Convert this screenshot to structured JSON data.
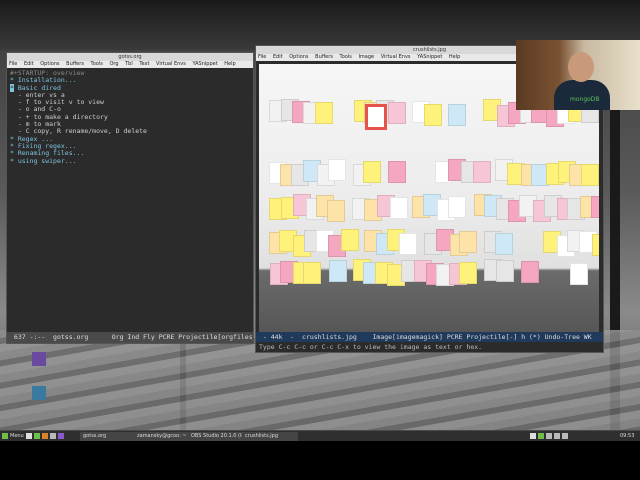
{
  "left_window": {
    "title": "gotss.org",
    "menu": [
      "File",
      "Edit",
      "Options",
      "Buffers",
      "Tools",
      "Org",
      "Tbl",
      "Text",
      "Virtual Envs",
      "YASnippet",
      "Help"
    ],
    "startup_line": "#+STARTUP: overview",
    "lines": [
      {
        "text": "* Installation...",
        "style": "hdr"
      },
      {
        "text": "",
        "style": ""
      },
      {
        "text": "* Basic dired",
        "style": "hdr-cursor"
      },
      {
        "text": "  - enter vs a",
        "style": ""
      },
      {
        "text": "  - f to visit v to view",
        "style": ""
      },
      {
        "text": "  - o and C-o",
        "style": ""
      },
      {
        "text": "  - + to make a directory",
        "style": ""
      },
      {
        "text": "  - m to mark",
        "style": ""
      },
      {
        "text": "  - C copy, R rename/move, D delete",
        "style": ""
      },
      {
        "text": "",
        "style": ""
      },
      {
        "text": "* Regex ...",
        "style": "hdr"
      },
      {
        "text": "",
        "style": ""
      },
      {
        "text": "* Fixing regex...",
        "style": "hdr"
      },
      {
        "text": "",
        "style": ""
      },
      {
        "text": "* Renaming files...",
        "style": "hdr"
      },
      {
        "text": "",
        "style": ""
      },
      {
        "text": "* using swiper...",
        "style": "hdr"
      }
    ],
    "modeline": " 637 -:--  gotss.org      Org Ind Fly PCRE Projectile[orgfiles] h (+)"
  },
  "right_window": {
    "title": "crushlists.jpg",
    "menu": [
      "File",
      "Edit",
      "Options",
      "Buffers",
      "Tools",
      "Image",
      "Virtual Envs",
      "YASnippet",
      "Help"
    ],
    "modeline": " - 44k  -  crushlists.jpg    Image[imagemagick] PCRE Projectile[-] h (*) Undo-Tree WK   Mail [23",
    "minibuffer": "Type C-c C-c or C-c C-x to view the image as text or hex."
  },
  "webcam": {
    "shirt_text": "mongoDB"
  },
  "desktop_icons": [
    {
      "label": "",
      "color": "#6a4aa0"
    },
    {
      "label": "",
      "color": "#3a7aa0"
    }
  ],
  "taskbar": {
    "menu_label": "Menu",
    "tasks": [
      "gotss.org",
      "zamansky@gcoo: ~",
      "OBS Studio 20.1.0 (li...",
      "crushlists.jpg"
    ],
    "clock": "09:53"
  },
  "colors": {
    "org_heading": "#7ec3e0",
    "modeline_right": "#1f3a5a",
    "red_sticky": "#e5534b",
    "blue_sticky": "#7ec3e0"
  }
}
